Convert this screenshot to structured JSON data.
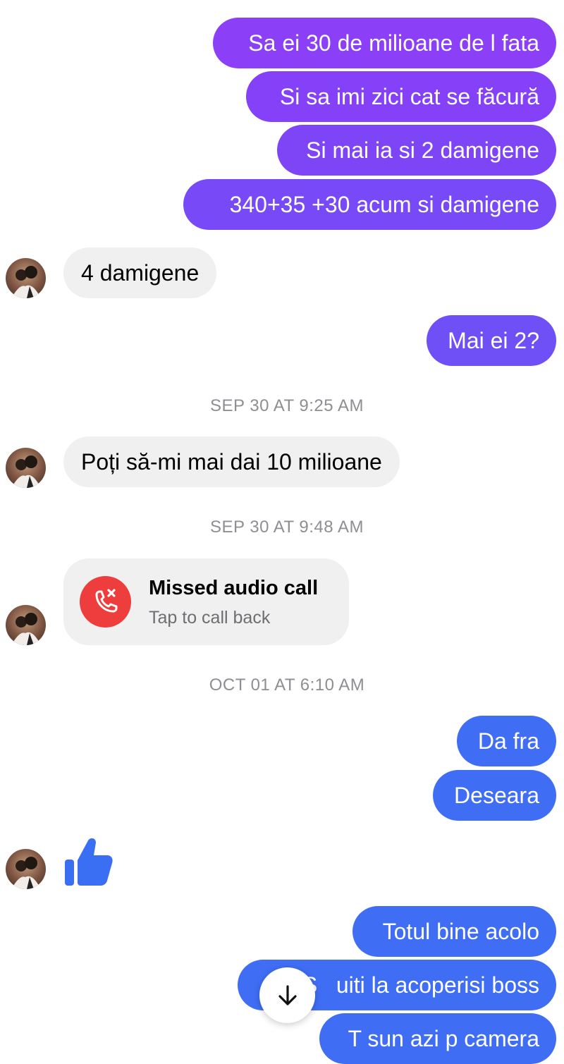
{
  "colors": {
    "outgoing_purple": "#8a3ff8",
    "outgoing_violet": "#7c48f7",
    "outgoing_blue": "#3f6df5",
    "incoming_bubble": "#f0f0f0",
    "missed_call_red": "#ee3d3d",
    "like_blue": "#3b6ff3",
    "timestamp": "#8e8e93"
  },
  "messages": {
    "m1": "Sa ei 30 de milioane de l fata",
    "m2": "Si sa imi zici cat se făcură",
    "m3": "Si mai ia si 2 damigene",
    "m4": "340+35 +30 acum si damigene",
    "m5": "4 damigene",
    "m6": "Mai ei 2?",
    "m7": "Poți să-mi mai dai 10 milioane",
    "m8": "Da fra",
    "m9": "Deseara",
    "m10": "Totul bine acolo",
    "m11": "S   uiti la acoperisi boss",
    "m12": "T sun azi p camera"
  },
  "timestamps": {
    "t1": "SEP 30 AT 9:25 AM",
    "t2": "SEP 30 AT 9:48 AM",
    "t3": "OCT 01 AT 6:10 AM"
  },
  "missed_call": {
    "title": "Missed audio call",
    "subtitle": "Tap to call back",
    "icon": "missed-call-icon"
  },
  "reactions": {
    "like_icon": "thumbs-up-icon"
  },
  "controls": {
    "scroll_icon": "arrow-down-icon"
  }
}
